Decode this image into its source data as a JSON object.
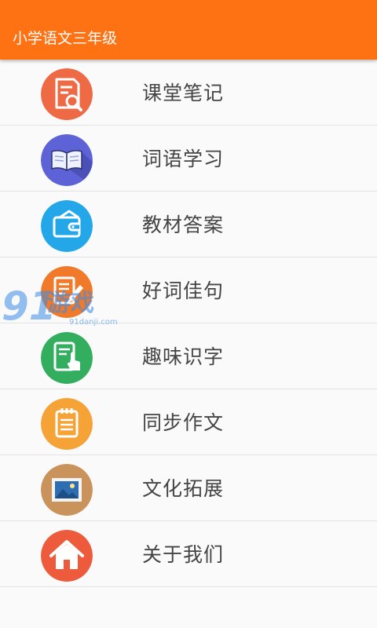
{
  "appbar": {
    "title": "小学语文三年级",
    "color": "#ff7214"
  },
  "menu": {
    "items": [
      {
        "label": "课堂笔记",
        "icon": "notes-search-icon",
        "color": "#ee6a45"
      },
      {
        "label": "词语学习",
        "icon": "open-book-icon",
        "color": "#5d63d6"
      },
      {
        "label": "教材答案",
        "icon": "wallet-icon",
        "color": "#23a7e8"
      },
      {
        "label": "好词佳句",
        "icon": "document-pen-icon",
        "color": "#f07a2a"
      },
      {
        "label": "趣味识字",
        "icon": "tablet-touch-icon",
        "color": "#33ad5e"
      },
      {
        "label": "同步作文",
        "icon": "notepad-icon",
        "color": "#f5a236"
      },
      {
        "label": "文化拓展",
        "icon": "picture-frame-icon",
        "color": "#c9935b"
      },
      {
        "label": "关于我们",
        "icon": "home-icon",
        "color": "#ee5a3c"
      }
    ]
  },
  "watermark": {
    "number": "91",
    "text": "游戏",
    "site": "91danji.com"
  }
}
